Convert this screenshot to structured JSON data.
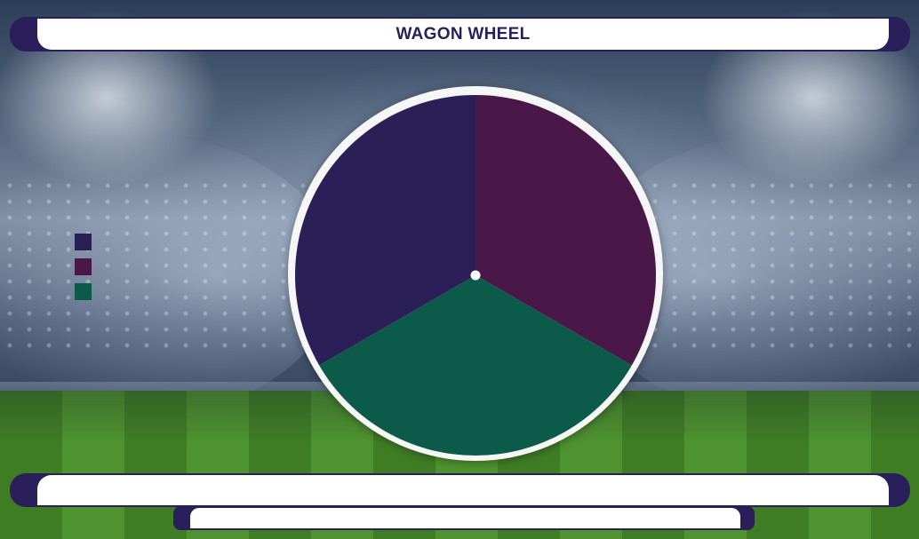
{
  "header": {
    "title": "WAGON WHEEL"
  },
  "colors": {
    "brand_navy": "#2a1f5a",
    "segment_purple": "#2b1f58",
    "segment_plum": "#4a1848",
    "segment_green": "#0b5a4a"
  },
  "legend": {
    "items": [
      {
        "color": "#2b1f58"
      },
      {
        "color": "#4a1848"
      },
      {
        "color": "#0b5a4a"
      }
    ]
  },
  "wheel": {
    "segments": [
      {
        "color": "#2b1f58",
        "share": 0.3333
      },
      {
        "color": "#4a1848",
        "share": 0.3333
      },
      {
        "color": "#0b5a4a",
        "share": 0.3334
      }
    ]
  }
}
